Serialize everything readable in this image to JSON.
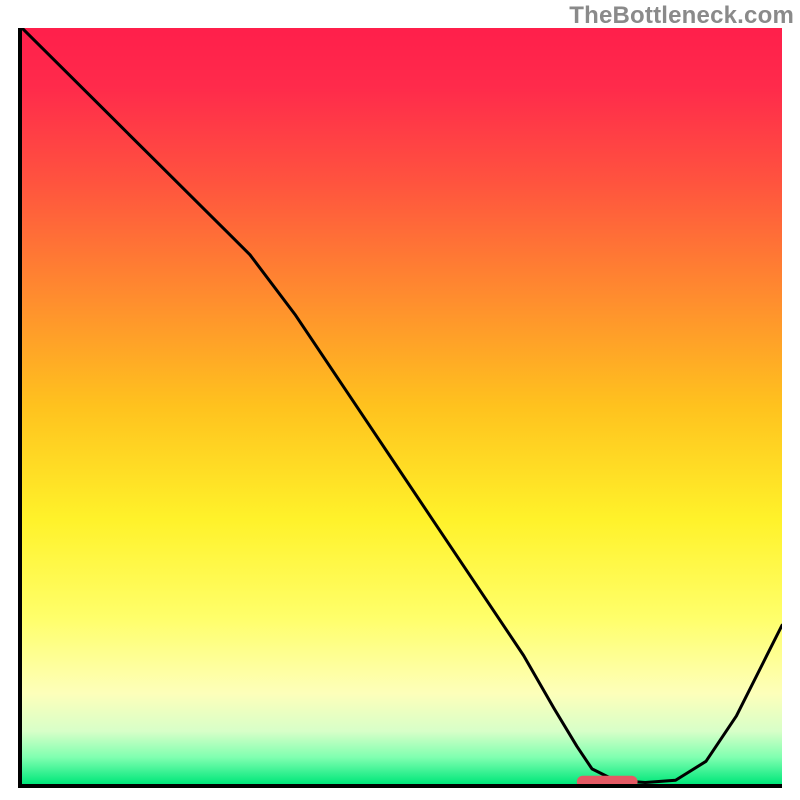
{
  "watermark": "TheBottleneck.com",
  "chart_data": {
    "type": "line",
    "title": "",
    "xlabel": "",
    "ylabel": "",
    "xlim": [
      0,
      100
    ],
    "ylim": [
      0,
      100
    ],
    "background_gradient": {
      "stops": [
        {
          "offset": 0.0,
          "color": "#ff1f4b"
        },
        {
          "offset": 0.08,
          "color": "#ff2b4b"
        },
        {
          "offset": 0.2,
          "color": "#ff523f"
        },
        {
          "offset": 0.35,
          "color": "#ff8a2f"
        },
        {
          "offset": 0.5,
          "color": "#ffc21e"
        },
        {
          "offset": 0.65,
          "color": "#fff22a"
        },
        {
          "offset": 0.78,
          "color": "#ffff6a"
        },
        {
          "offset": 0.88,
          "color": "#fdffba"
        },
        {
          "offset": 0.93,
          "color": "#d8ffc8"
        },
        {
          "offset": 0.965,
          "color": "#7fffb0"
        },
        {
          "offset": 1.0,
          "color": "#00e77a"
        }
      ]
    },
    "series": [
      {
        "name": "curve",
        "x": [
          0,
          6,
          12,
          18,
          24,
          27,
          30,
          36,
          42,
          48,
          54,
          60,
          66,
          70,
          73,
          75,
          78,
          82,
          86,
          90,
          94,
          98,
          100
        ],
        "y": [
          100,
          94,
          88,
          82,
          76,
          73,
          70,
          62,
          53,
          44,
          35,
          26,
          17,
          10,
          5,
          2,
          0.5,
          0.2,
          0.5,
          3,
          9,
          17,
          21
        ]
      }
    ],
    "marker": {
      "name": "highlight-segment",
      "x_center": 77,
      "y": 0.3,
      "width_x": 8,
      "color": "#e45a64",
      "radius": 3
    }
  }
}
